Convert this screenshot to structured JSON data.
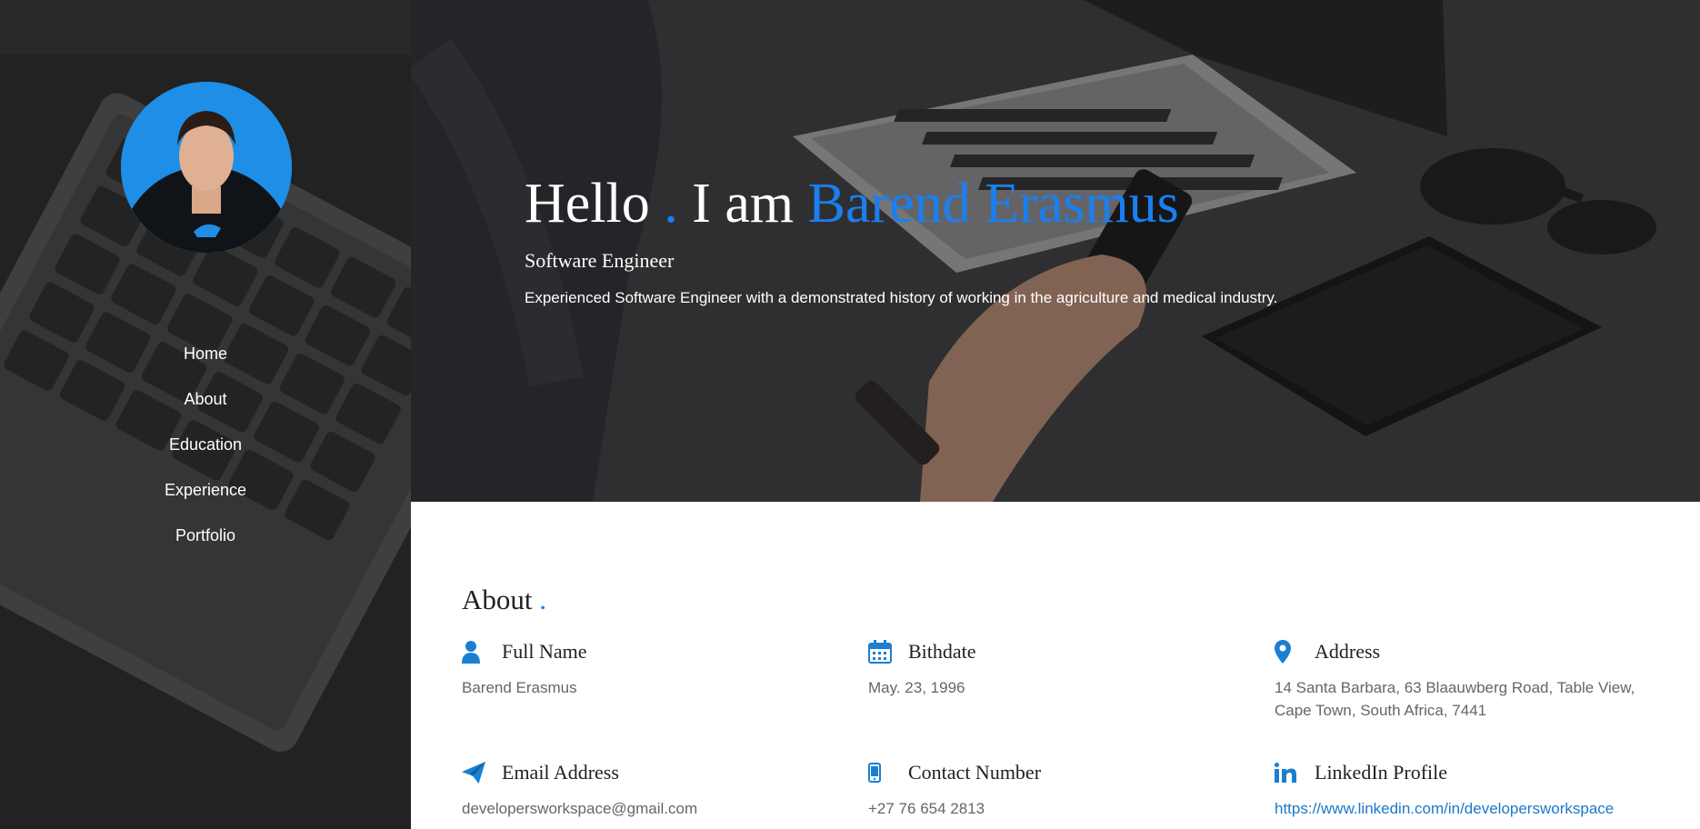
{
  "colors": {
    "accent": "#1a7ff0",
    "sidebar_bg": "#2e2e2e",
    "icon_blue": "#1b7fd1"
  },
  "nav": {
    "items": [
      "Home",
      "About",
      "Education",
      "Experience",
      "Portfolio"
    ]
  },
  "hero": {
    "greeting": "Hello",
    "dot": ".",
    "intro": "I am",
    "name": "Barend Erasmus",
    "role": "Software Engineer",
    "description": "Experienced Software Engineer with a demonstrated history of working in the agriculture and medical industry."
  },
  "about": {
    "title": "About",
    "dot": ".",
    "items": [
      {
        "icon": "user-icon",
        "label": "Full Name",
        "value": "Barend Erasmus"
      },
      {
        "icon": "calendar-icon",
        "label": "Bithdate",
        "value": "May. 23, 1996"
      },
      {
        "icon": "map-marker-icon",
        "label": "Address",
        "value": "14 Santa Barbara, 63 Blaauwberg Road, Table View, Cape Town, South Africa, 7441"
      },
      {
        "icon": "paper-plane-icon",
        "label": "Email Address",
        "value": "developersworkspace@gmail.com"
      },
      {
        "icon": "mobile-phone-icon",
        "label": "Contact Number",
        "value": "+27 76 654 2813"
      },
      {
        "icon": "linkedin-icon",
        "label": "LinkedIn Profile",
        "value": "https://www.linkedin.com/in/developersworkspace"
      }
    ]
  }
}
